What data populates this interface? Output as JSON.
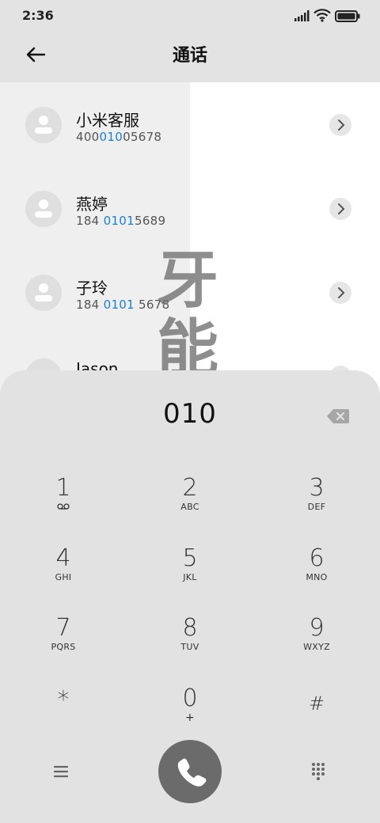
{
  "status_bar": {
    "time": "2:36"
  },
  "header": {
    "title": "通话"
  },
  "contacts": [
    {
      "name": "小米客服",
      "num_pre": "400",
      "num_hl": "010",
      "num_post": "05678"
    },
    {
      "name": "燕婷",
      "num_pre": "184 ",
      "num_hl": "0101",
      "num_post": "5689"
    },
    {
      "name": "子玲",
      "num_pre": "184 ",
      "num_hl": "0101",
      "num_post": " 5678"
    },
    {
      "name": "Jason",
      "num_pre": "",
      "num_hl": "",
      "num_post": ""
    }
  ],
  "watermark": "牙能",
  "dialer": {
    "input": "010",
    "keys": [
      {
        "digit": "1",
        "letters": "⌂"
      },
      {
        "digit": "2",
        "letters": "ABC"
      },
      {
        "digit": "3",
        "letters": "DEF"
      },
      {
        "digit": "4",
        "letters": "GHI"
      },
      {
        "digit": "5",
        "letters": "JKL"
      },
      {
        "digit": "6",
        "letters": "MNO"
      },
      {
        "digit": "7",
        "letters": "PQRS"
      },
      {
        "digit": "8",
        "letters": "TUV"
      },
      {
        "digit": "9",
        "letters": "WXYZ"
      },
      {
        "digit": "*",
        "letters": ""
      },
      {
        "digit": "0",
        "letters": "+"
      },
      {
        "digit": "#",
        "letters": ""
      }
    ]
  },
  "colors": {
    "highlight": "#1a7fd6",
    "call_button": "#6b6b6b",
    "sheet": "#e2e2e2"
  }
}
